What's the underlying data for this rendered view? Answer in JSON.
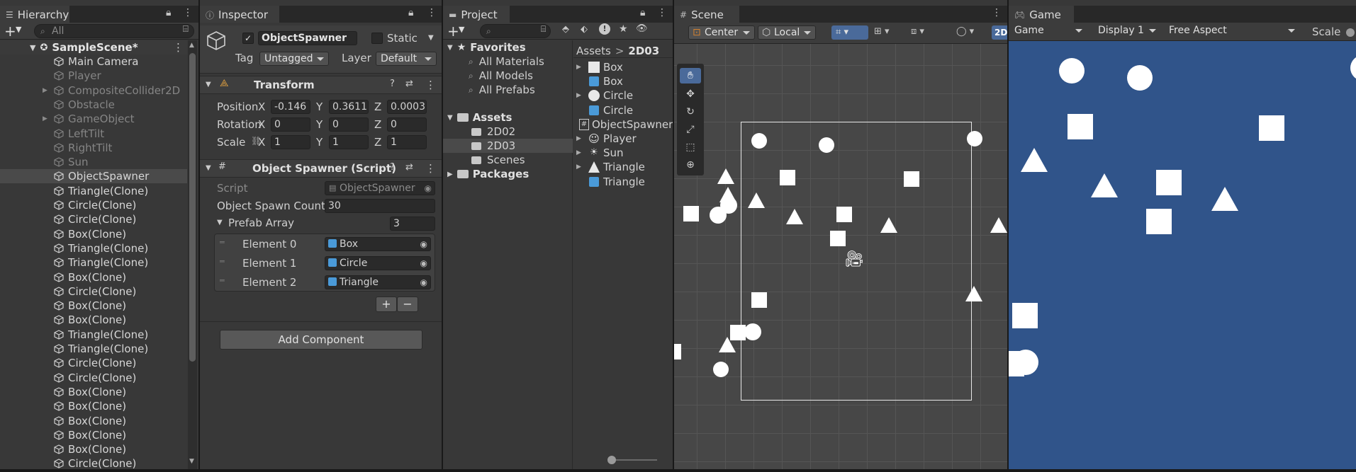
{
  "hierarchy": {
    "tab": "Hierarchy",
    "search_placeholder": "All",
    "scene": "SampleScene*",
    "items": [
      {
        "label": "Main Camera",
        "dim": false,
        "arrow": false,
        "sel": false
      },
      {
        "label": "Player",
        "dim": true,
        "arrow": false,
        "sel": false
      },
      {
        "label": "CompositeCollider2D",
        "dim": true,
        "arrow": true,
        "sel": false
      },
      {
        "label": "Obstacle",
        "dim": true,
        "arrow": false,
        "sel": false
      },
      {
        "label": "GameObject",
        "dim": true,
        "arrow": true,
        "sel": false
      },
      {
        "label": "LeftTilt",
        "dim": true,
        "arrow": false,
        "sel": false
      },
      {
        "label": "RightTilt",
        "dim": true,
        "arrow": false,
        "sel": false
      },
      {
        "label": "Sun",
        "dim": true,
        "arrow": false,
        "sel": false
      },
      {
        "label": "ObjectSpawner",
        "dim": false,
        "arrow": false,
        "sel": true
      },
      {
        "label": "Triangle(Clone)",
        "dim": false,
        "arrow": false,
        "sel": false
      },
      {
        "label": "Circle(Clone)",
        "dim": false,
        "arrow": false,
        "sel": false
      },
      {
        "label": "Circle(Clone)",
        "dim": false,
        "arrow": false,
        "sel": false
      },
      {
        "label": "Box(Clone)",
        "dim": false,
        "arrow": false,
        "sel": false
      },
      {
        "label": "Triangle(Clone)",
        "dim": false,
        "arrow": false,
        "sel": false
      },
      {
        "label": "Triangle(Clone)",
        "dim": false,
        "arrow": false,
        "sel": false
      },
      {
        "label": "Box(Clone)",
        "dim": false,
        "arrow": false,
        "sel": false
      },
      {
        "label": "Circle(Clone)",
        "dim": false,
        "arrow": false,
        "sel": false
      },
      {
        "label": "Box(Clone)",
        "dim": false,
        "arrow": false,
        "sel": false
      },
      {
        "label": "Box(Clone)",
        "dim": false,
        "arrow": false,
        "sel": false
      },
      {
        "label": "Triangle(Clone)",
        "dim": false,
        "arrow": false,
        "sel": false
      },
      {
        "label": "Triangle(Clone)",
        "dim": false,
        "arrow": false,
        "sel": false
      },
      {
        "label": "Circle(Clone)",
        "dim": false,
        "arrow": false,
        "sel": false
      },
      {
        "label": "Circle(Clone)",
        "dim": false,
        "arrow": false,
        "sel": false
      },
      {
        "label": "Box(Clone)",
        "dim": false,
        "arrow": false,
        "sel": false
      },
      {
        "label": "Box(Clone)",
        "dim": false,
        "arrow": false,
        "sel": false
      },
      {
        "label": "Box(Clone)",
        "dim": false,
        "arrow": false,
        "sel": false
      },
      {
        "label": "Box(Clone)",
        "dim": false,
        "arrow": false,
        "sel": false
      },
      {
        "label": "Box(Clone)",
        "dim": false,
        "arrow": false,
        "sel": false
      },
      {
        "label": "Circle(Clone)",
        "dim": false,
        "arrow": false,
        "sel": false
      }
    ]
  },
  "inspector": {
    "tab": "Inspector",
    "object_name": "ObjectSpawner",
    "static_label": "Static",
    "tag_label": "Tag",
    "tag_value": "Untagged",
    "layer_label": "Layer",
    "layer_value": "Default",
    "transform": {
      "title": "Transform",
      "position_label": "Position",
      "rotation_label": "Rotation",
      "scale_label": "Scale",
      "x": "X",
      "y": "Y",
      "z": "Z",
      "position": [
        "-0.146",
        "0.3611",
        "0.0003"
      ],
      "rotation": [
        "0",
        "0",
        "0"
      ],
      "scale": [
        "1",
        "1",
        "1"
      ]
    },
    "script_comp": {
      "title": "Object Spawner (Script)",
      "script_label": "Script",
      "script_value": "ObjectSpawner",
      "count_label": "Object Spawn Count",
      "count_value": "30",
      "array_label": "Prefab Array",
      "array_size": "3",
      "elements": [
        {
          "label": "Element 0",
          "value": "Box"
        },
        {
          "label": "Element 1",
          "value": "Circle"
        },
        {
          "label": "Element 2",
          "value": "Triangle"
        }
      ],
      "plus": "+",
      "minus": "−"
    },
    "add_component": "Add Component"
  },
  "project": {
    "tab": "Project",
    "favorites": "Favorites",
    "fav_items": [
      "All Materials",
      "All Models",
      "All Prefabs"
    ],
    "assets": "Assets",
    "asset_folders": [
      "2D02",
      "2D03",
      "Scenes"
    ],
    "packages": "Packages",
    "breadcrumb_root": "Assets",
    "breadcrumb_sep": ">",
    "breadcrumb_leaf": "2D03",
    "files": [
      {
        "label": "Box",
        "icon": "sprite-square-icon",
        "arrow": true
      },
      {
        "label": "Box",
        "icon": "prefab-icon",
        "arrow": false
      },
      {
        "label": "Circle",
        "icon": "sprite-circle-icon",
        "arrow": true
      },
      {
        "label": "Circle",
        "icon": "prefab-icon",
        "arrow": false
      },
      {
        "label": "ObjectSpawner",
        "icon": "script-icon",
        "arrow": false
      },
      {
        "label": "Player",
        "icon": "sprite-face-icon",
        "arrow": true
      },
      {
        "label": "Sun",
        "icon": "sprite-sun-icon",
        "arrow": true
      },
      {
        "label": "Triangle",
        "icon": "sprite-triangle-icon",
        "arrow": true
      },
      {
        "label": "Triangle",
        "icon": "prefab-icon",
        "arrow": false
      }
    ]
  },
  "scene": {
    "tab": "Scene",
    "pivot": "Center",
    "space": "Local",
    "mode_2d": "2D"
  },
  "game": {
    "tab": "Game",
    "view": "Game",
    "display": "Display 1",
    "aspect": "Free Aspect",
    "scale": "Scale"
  },
  "colors": {
    "accent": "#4a7bc8",
    "game_bg": "#30548a",
    "selection": "#4a4a4a"
  }
}
